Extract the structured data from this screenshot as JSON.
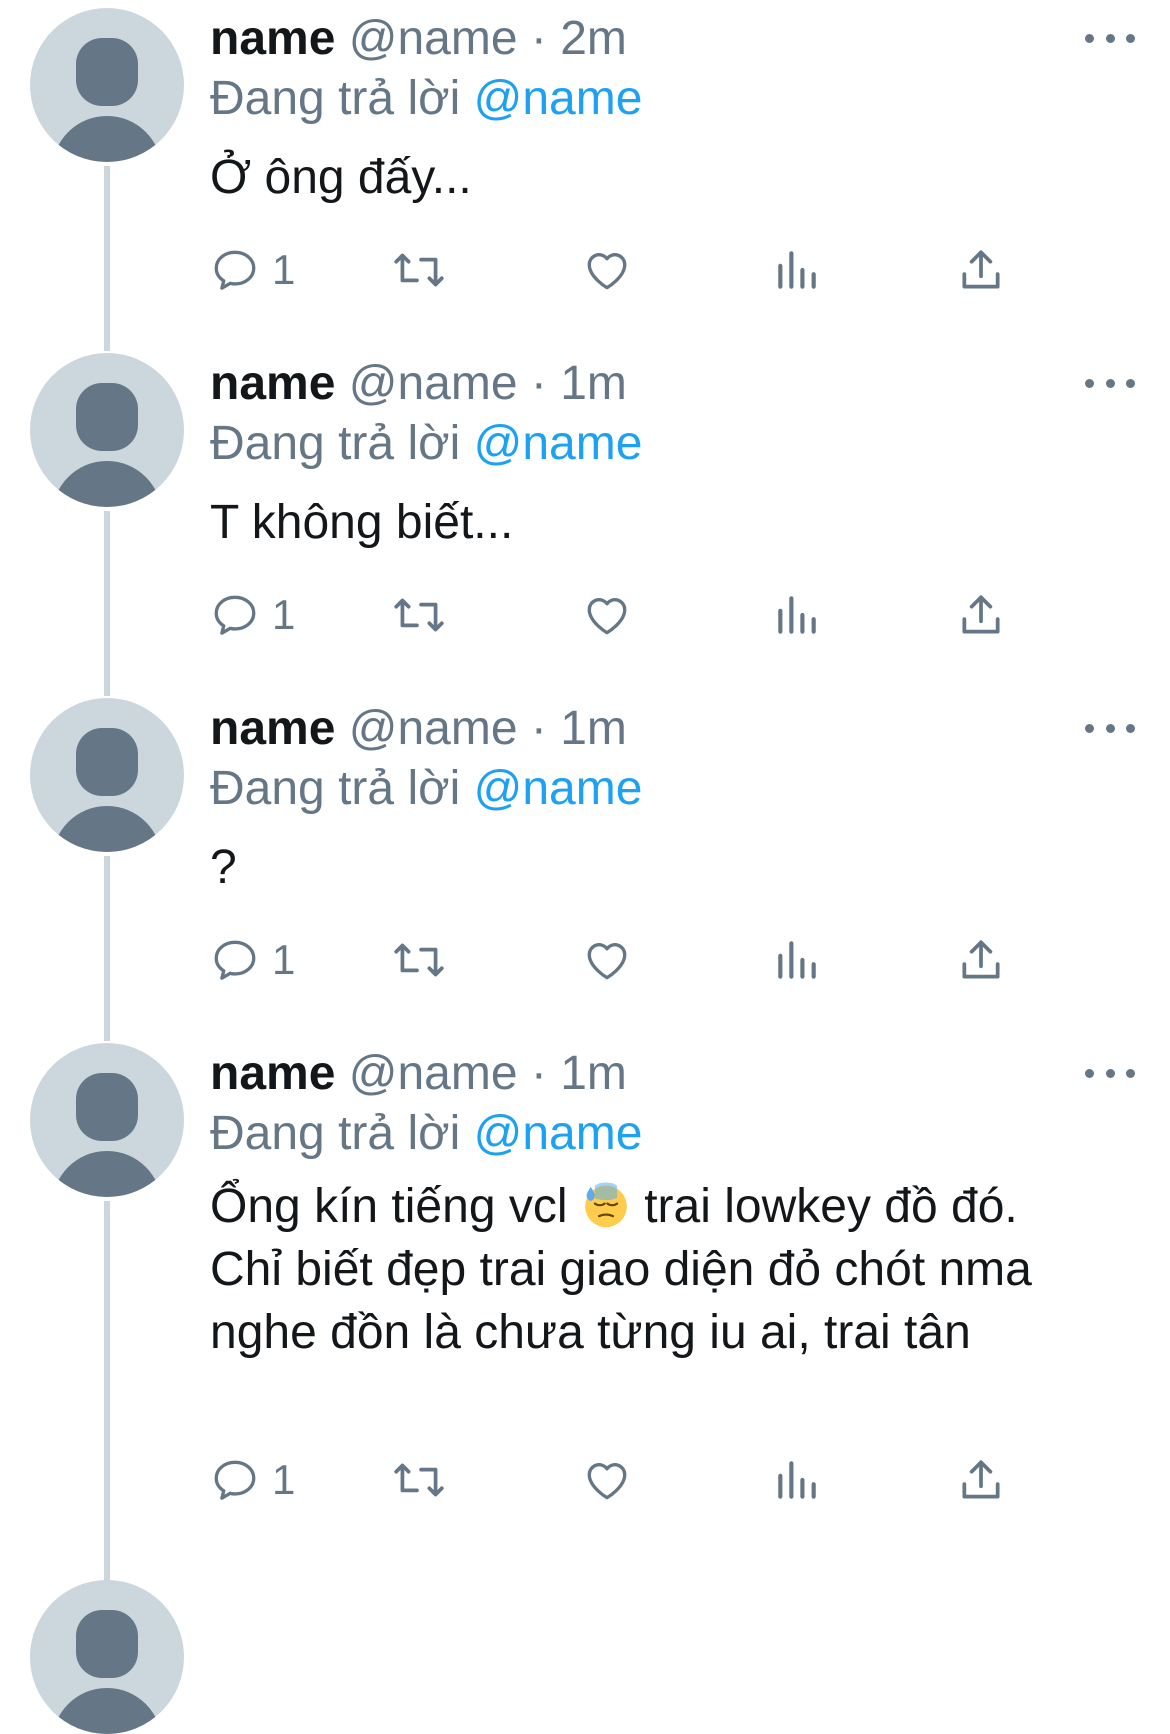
{
  "colors": {
    "primary_text": "#14171a",
    "secondary_text": "#657786",
    "link": "#1da1f2",
    "avatar_bg": "#ccd6dd",
    "thread_line": "#ccd6dd"
  },
  "tweets": [
    {
      "display_name": "name",
      "handle": "@name",
      "separator": "·",
      "time": "2m",
      "replying_prefix": "Đang trả lời",
      "replying_to": "@name",
      "text": "Ở ông đấy...",
      "reply_count": "1"
    },
    {
      "display_name": "name",
      "handle": "@name",
      "separator": "·",
      "time": "1m",
      "replying_prefix": "Đang trả lời",
      "replying_to": "@name",
      "text": "T không biết...",
      "reply_count": "1"
    },
    {
      "display_name": "name",
      "handle": "@name",
      "separator": "·",
      "time": "1m",
      "replying_prefix": "Đang trả lời",
      "replying_to": "@name",
      "text": "?",
      "reply_count": "1"
    },
    {
      "display_name": "name",
      "handle": "@name",
      "separator": "·",
      "time": "1m",
      "replying_prefix": "Đang trả lời",
      "replying_to": "@name",
      "text_before_emoji": "Ổng kín tiếng vcl",
      "emoji": "downcast-face-with-sweat",
      "text_after_emoji": " trai lowkey đồ đó. Chỉ biết đẹp trai giao diện đỏ chót nma nghe đồn là chưa từng iu ai, trai tân",
      "reply_count": "1"
    }
  ],
  "icons": {
    "reply": "reply-icon",
    "retweet": "retweet-icon",
    "like": "heart-icon",
    "views": "views-icon",
    "share": "share-icon",
    "more": "more-icon"
  }
}
